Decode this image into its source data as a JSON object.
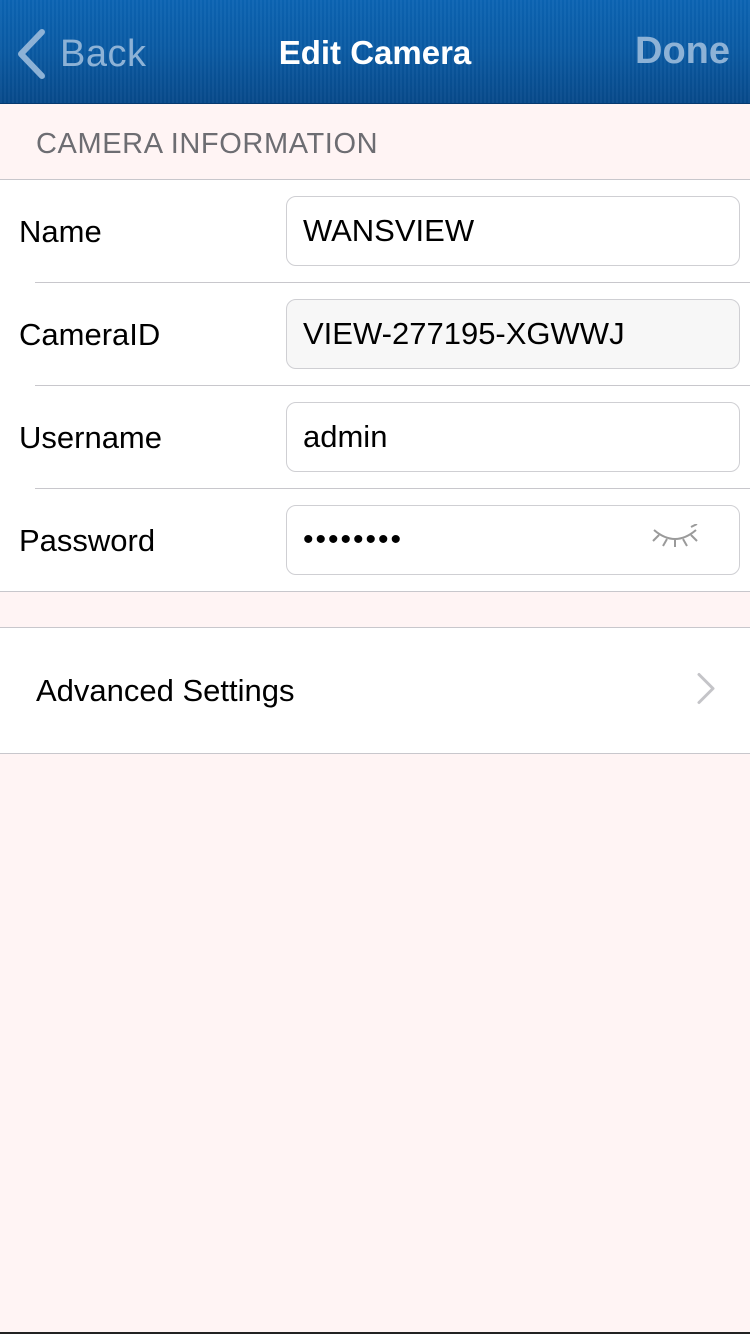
{
  "navbar": {
    "back_label": "Back",
    "title": "Edit Camera",
    "done_label": "Done",
    "back_icon": "chevron-left-icon"
  },
  "camera_info": {
    "section_title": "CAMERA INFORMATION",
    "fields": {
      "name": {
        "label": "Name",
        "value": "WANSVIEW"
      },
      "camera_id": {
        "label": "CameraID",
        "value": "VIEW-277195-XGWWJ"
      },
      "username": {
        "label": "Username",
        "value": "admin"
      },
      "password": {
        "label": "Password",
        "value": "••••••••",
        "toggle_icon": "eye-closed-icon"
      }
    }
  },
  "advanced": {
    "label": "Advanced Settings",
    "icon": "chevron-right-icon"
  },
  "colors": {
    "nav_background": "#0a5aa3",
    "nav_button_text": "#8db2d6",
    "page_background": "#fff4f4",
    "separator": "#c8c7cc"
  }
}
